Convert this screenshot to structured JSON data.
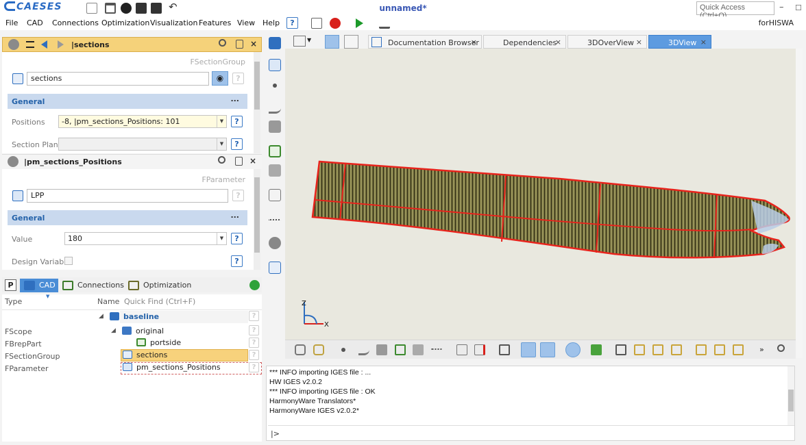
{
  "app": {
    "logo": "CAESES",
    "title": "unnamed*",
    "quick_access": "Quick Access (Ctrl+Q)",
    "user": "forHISWA"
  },
  "menu": [
    "File",
    "CAD",
    "Connections",
    "Optimization",
    "Visualization",
    "Features",
    "View",
    "Help"
  ],
  "panel1": {
    "title": "|sections",
    "class": "FSectionGroup",
    "name": "sections",
    "section": "General",
    "positions_label": "Positions",
    "positions_value": "-8, |pm_sections_Positions: 101",
    "plane_label": "Section Plane",
    "plane_value": ""
  },
  "panel2": {
    "title": "|pm_sections_Positions",
    "class": "FParameter",
    "name": "LPP",
    "section": "General",
    "value_label": "Value",
    "value": "180",
    "design_label": "Design Variable"
  },
  "help_glyph": "?",
  "dots": "...",
  "tree": {
    "tabs": [
      "CAD",
      "Connections",
      "Optimization"
    ],
    "p_label": "P",
    "headers": {
      "type": "Type",
      "name": "Name",
      "find": "Quick Find (Ctrl+F)"
    },
    "types": [
      "FScope",
      "FBrepPart",
      "FSectionGroup",
      "FParameter"
    ],
    "nodes": [
      "baseline",
      "original",
      "portside",
      "sections",
      "pm_sections_Positions"
    ]
  },
  "view_tabs": [
    "Documentation Browser",
    "Dependencies",
    "3DOverView",
    "3DView"
  ],
  "axis": {
    "z": "Z",
    "x": "X"
  },
  "console": {
    "lines": [
      "*** INFO importing IGES file : ...",
      "HW IGES v2.0.2",
      "*** INFO importing IGES file : OK",
      "HarmonyWare Translators*",
      "HarmonyWare IGES v2.0.2*"
    ],
    "prompt": "|>"
  },
  "colors": {
    "accent": "#4a8dd6",
    "panel_active": "#f5d27a",
    "section": "#c9d9ee",
    "hull": "#6f6b3a",
    "outline": "#e8231c",
    "title": "#3a58b5"
  }
}
